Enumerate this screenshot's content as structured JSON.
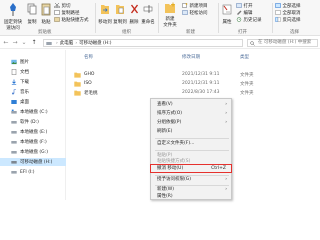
{
  "ribbon": {
    "clipboard": {
      "pin_line1": "固定到快",
      "pin_line2": "速访问",
      "copy": "复制",
      "paste": "粘贴",
      "cut": "剪切",
      "copy_path": "复制路径",
      "paste_shortcut": "粘贴快捷方式",
      "label": "剪贴板"
    },
    "organize": {
      "move_to": "移动到",
      "copy_to": "复制到",
      "delete": "删除",
      "rename": "重命名",
      "label": "组织"
    },
    "new": {
      "new_folder_line1": "新建",
      "new_folder_line2": "文件夹",
      "new_item": "新建项目",
      "easy_access": "轻松访问",
      "label": "新建"
    },
    "open": {
      "properties": "属性",
      "open": "打开",
      "edit": "编辑",
      "history": "历史记录",
      "label": "打开"
    },
    "select": {
      "select_all": "全部选择",
      "select_none": "全部取消",
      "invert": "反向选择",
      "label": "选择"
    }
  },
  "address": {
    "back": "←",
    "forward": "→",
    "recent": "⌄",
    "up": "↑",
    "crumb1": "此电脑",
    "crumb2": "可移动磁盘 (H:)",
    "search_placeholder": "在 可移动磁盘 (H:) 中搜索"
  },
  "nav": [
    {
      "label": "图片"
    },
    {
      "label": "文档"
    },
    {
      "label": "下载"
    },
    {
      "label": "音乐"
    },
    {
      "label": "桌面"
    },
    {
      "label": "本地磁盘 (C:)"
    },
    {
      "label": "软件 (D:)"
    },
    {
      "label": "本地磁盘 (E:)"
    },
    {
      "label": "本地磁盘 (F:)"
    },
    {
      "label": "本地磁盘 (G:)"
    },
    {
      "label": "可移动磁盘 (H:)"
    },
    {
      "label": "EFI (I:)"
    }
  ],
  "list": {
    "columns": {
      "name": "名称",
      "date": "修改日期",
      "type": "类型"
    },
    "rows": [
      {
        "name": "GHO",
        "date": "2021/12/31 9:11",
        "type": "文件夹"
      },
      {
        "name": "ISO",
        "date": "2021/12/31 9:11",
        "type": "文件夹"
      },
      {
        "name": "老毛桃",
        "date": "2022/8/30 17:43",
        "type": "文件夹"
      }
    ]
  },
  "context_menu": {
    "view": "查看(V)",
    "sort": "排序方式(O)",
    "group": "分组依据(P)",
    "refresh": "刷新(E)",
    "customize": "自定义文件夹(F)...",
    "paste": "粘贴(P)",
    "paste_shortcut": "粘贴快捷方式(S)",
    "undo": "撤消 移动(U)",
    "undo_shortcut": "Ctrl+Z",
    "give_access": "授予访问权限(G)",
    "new": "新建(W)",
    "properties": "属性(R)"
  },
  "colors": {
    "folder": "#f3c35a",
    "accent": "#1e6fd0",
    "highlight": "#e5312d",
    "selected": "#cce8ff"
  },
  "icons": [
    "pin-icon",
    "copy-icon",
    "paste-icon",
    "cut-icon",
    "move-to-icon",
    "copy-to-icon",
    "delete-icon",
    "rename-icon",
    "new-folder-icon",
    "new-item-icon",
    "properties-icon",
    "open-icon",
    "edit-icon",
    "history-icon",
    "select-all-icon",
    "search-icon",
    "folder-icon",
    "drive-icon"
  ]
}
